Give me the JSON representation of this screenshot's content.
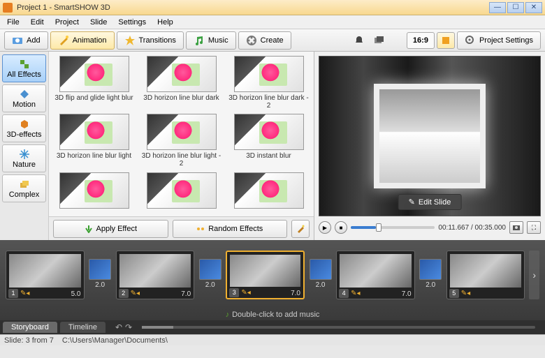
{
  "window": {
    "title": "Project 1 - SmartSHOW 3D"
  },
  "menu": [
    "File",
    "Edit",
    "Project",
    "Slide",
    "Settings",
    "Help"
  ],
  "tabs": {
    "add": "Add",
    "animation": "Animation",
    "transitions": "Transitions",
    "music": "Music",
    "create": "Create"
  },
  "toolbar": {
    "aspect": "16:9",
    "settings": "Project Settings"
  },
  "categories": [
    {
      "label": "All Effects",
      "selected": true
    },
    {
      "label": "Motion"
    },
    {
      "label": "3D-effects"
    },
    {
      "label": "Nature"
    },
    {
      "label": "Complex"
    }
  ],
  "effects": [
    "3D flip and glide light blur",
    "3D horizon line blur dark",
    "3D horizon line blur dark - 2",
    "3D horizon line blur light",
    "3D horizon line blur light - 2",
    "3D instant blur",
    "",
    "",
    ""
  ],
  "actions": {
    "apply": "Apply Effect",
    "random": "Random Effects"
  },
  "preview": {
    "edit": "Edit Slide",
    "time": "00:11.667 / 00:35.000"
  },
  "slides": [
    {
      "n": "1",
      "dur": "5.0"
    },
    {
      "n": "2",
      "dur": "7.0"
    },
    {
      "n": "3",
      "dur": "7.0",
      "selected": true
    },
    {
      "n": "4",
      "dur": "7.0"
    },
    {
      "n": "5",
      "dur": ""
    }
  ],
  "transitions_dur": [
    "2.0",
    "2.0",
    "2.0",
    "2.0"
  ],
  "music_hint": "Double-click to add music",
  "bottom_tabs": {
    "storyboard": "Storyboard",
    "timeline": "Timeline"
  },
  "status": {
    "slide": "Slide: 3 from 7",
    "path": "C:\\Users\\Manager\\Documents\\"
  }
}
